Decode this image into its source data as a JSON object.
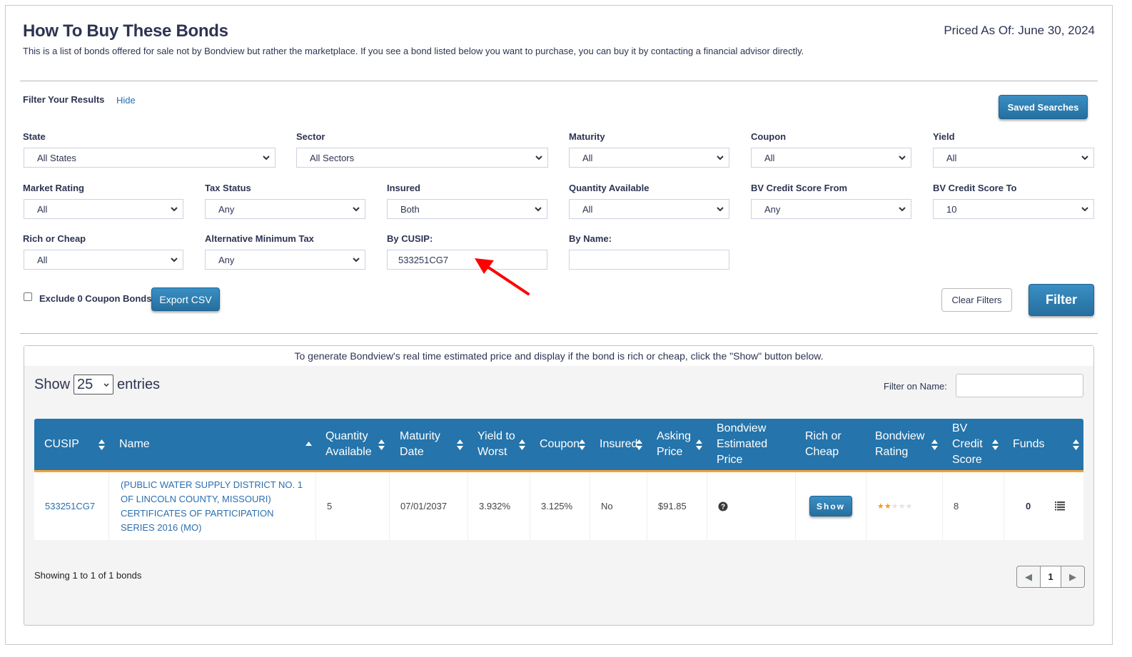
{
  "header": {
    "title": "How To Buy These Bonds",
    "subtitle": "This is a list of bonds offered for sale not by Bondview but rather the marketplace. If you see a bond listed below you want to purchase, you can buy it by contacting a financial advisor directly.",
    "priced_as_of": "Priced As Of: June 30, 2024"
  },
  "filters": {
    "heading": "Filter Your Results",
    "hide_link": "Hide",
    "saved_searches": "Saved Searches",
    "fields": {
      "state": {
        "label": "State",
        "value": "All States"
      },
      "sector": {
        "label": "Sector",
        "value": "All Sectors"
      },
      "maturity": {
        "label": "Maturity",
        "value": "All"
      },
      "coupon": {
        "label": "Coupon",
        "value": "All"
      },
      "yield": {
        "label": "Yield",
        "value": "All"
      },
      "market_rating": {
        "label": "Market Rating",
        "value": "All"
      },
      "tax_status": {
        "label": "Tax Status",
        "value": "Any"
      },
      "insured": {
        "label": "Insured",
        "value": "Both"
      },
      "quantity_available": {
        "label": "Quantity Available",
        "value": "All"
      },
      "bv_credit_from": {
        "label": "BV Credit Score From",
        "value": "Any"
      },
      "bv_credit_to": {
        "label": "BV Credit Score To",
        "value": "10"
      },
      "rich_or_cheap": {
        "label": "Rich or Cheap",
        "value": "All"
      },
      "amt": {
        "label": "Alternative Minimum Tax",
        "value": "Any"
      },
      "by_cusip": {
        "label": "By CUSIP:",
        "value": "533251CG7"
      },
      "by_name": {
        "label": "By Name:",
        "value": ""
      }
    },
    "exclude_zero_coupon": {
      "label": "Exclude 0 Coupon Bonds",
      "checked": false
    },
    "export_csv": "Export CSV",
    "clear_filters": "Clear Filters",
    "filter_button": "Filter"
  },
  "results": {
    "note": "To generate Bondview's real time estimated price and display if the bond is rich or cheap, click the \"Show\" button below.",
    "show_label": "Show",
    "entries_value": "25",
    "entries_label": "entries",
    "filter_on_name_label": "Filter on Name:",
    "filter_on_name_value": "",
    "columns": [
      {
        "line1": "CUSIP",
        "line2": "",
        "line3": ""
      },
      {
        "line1": "Name",
        "line2": "",
        "line3": ""
      },
      {
        "line1": "Quantity",
        "line2": "Available",
        "line3": ""
      },
      {
        "line1": "Maturity",
        "line2": "Date",
        "line3": ""
      },
      {
        "line1": "Yield to",
        "line2": "Worst",
        "line3": ""
      },
      {
        "line1": "Coupon",
        "line2": "",
        "line3": ""
      },
      {
        "line1": "Insured",
        "line2": "",
        "line3": ""
      },
      {
        "line1": "Asking",
        "line2": "Price",
        "line3": ""
      },
      {
        "line1": "Bondview",
        "line2": "Estimated",
        "line3": "Price"
      },
      {
        "line1": "Rich or",
        "line2": "Cheap",
        "line3": ""
      },
      {
        "line1": "Bondview",
        "line2": "Rating",
        "line3": ""
      },
      {
        "line1": "BV",
        "line2": "Credit",
        "line3": "Score"
      },
      {
        "line1": "Funds",
        "line2": "",
        "line3": ""
      }
    ],
    "rows": [
      {
        "cusip": "533251CG7",
        "name_lines": [
          "(PUBLIC WATER SUPPLY DISTRICT NO. 1",
          "OF LINCOLN COUNTY, MISSOURI)",
          "CERTIFICATES OF PARTICIPATION",
          "SERIES 2016 (MO)"
        ],
        "quantity": "5",
        "maturity": "07/01/2037",
        "ytw": "3.932%",
        "coupon": "3.125%",
        "insured": "No",
        "asking_price": "$91.85",
        "estimated_price_icon": "question-circle-icon",
        "rich_cheap_button": "Show",
        "rating_stars": 2,
        "rating_max": 5,
        "bv_credit_score": "8",
        "funds": "0",
        "funds_icon": "list-icon"
      }
    ],
    "showing": "Showing 1 to 1 of 1 bonds",
    "pagination": {
      "prev": "◀",
      "current": "1",
      "next": "▶"
    }
  },
  "colors": {
    "header_blue": "#2574ab",
    "accent_orange": "#f4a233",
    "link_blue": "#2a6fb0",
    "title_navy": "#2d3452",
    "annotation_red": "#ff0000"
  }
}
